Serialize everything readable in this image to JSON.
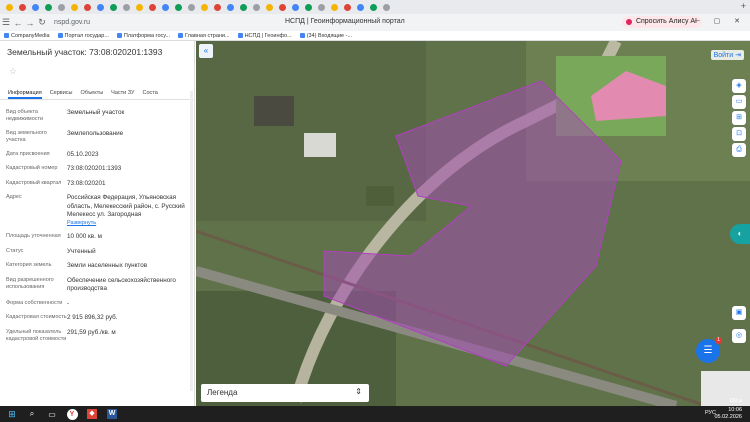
{
  "browser": {
    "url": "nspd.gov.ru",
    "window_title": "НСПД | Геоинформационный портал",
    "ask_button": "Спросить Алису AI",
    "bookmarks": [
      "CompanyMedia",
      "Портал государ...",
      "Платформа госу...",
      "Главная страни...",
      "НСПД | Геоинфо...",
      "(34) Входящие -..."
    ]
  },
  "panel": {
    "title": "Земельный участок: 73:08:020201:1393",
    "tabs": [
      "Информация",
      "Сервисы",
      "Объекты",
      "Части ЗУ",
      "Соста"
    ],
    "rows": [
      {
        "label": "Вид объекта недвижимости",
        "value": "Земельный участок"
      },
      {
        "label": "Вид земельного участка",
        "value": "Землепользование"
      },
      {
        "label": "Дата присвоения",
        "value": "05.10.2023"
      },
      {
        "label": "Кадастровый номер",
        "value": "73:08:020201:1393"
      },
      {
        "label": "Кадастровый квартал",
        "value": "73:08:020201"
      },
      {
        "label": "Адрес",
        "value": "Российская Федерация, Ульяновская область, Мелекесский район, с. Русский Мелекесс ул. Загородная",
        "link": "Развернуть"
      },
      {
        "label": "Площадь уточненная",
        "value": "10 000 кв. м"
      },
      {
        "label": "Статус",
        "value": "Учтенный"
      },
      {
        "label": "Категория земель",
        "value": "Земли населенных пунктов"
      },
      {
        "label": "Вид разрешенного использования",
        "value": "Обеспечение сельскохозяйственного производства"
      },
      {
        "label": "Форма собственности",
        "value": "-"
      },
      {
        "label": "Кадастровая стоимость",
        "value": "2 915 896,32 руб."
      },
      {
        "label": "Удельный показатель кадастровой стоимости",
        "value": "291,59 руб./кв. м"
      }
    ]
  },
  "map": {
    "login": "Войти",
    "legend": "Легенда",
    "chat_badge": "1",
    "scale": "100 м",
    "parcel_color": "#a24db0"
  },
  "taskbar": {
    "lang": "РУС",
    "time": "10:06",
    "date": "05.02.2026"
  }
}
